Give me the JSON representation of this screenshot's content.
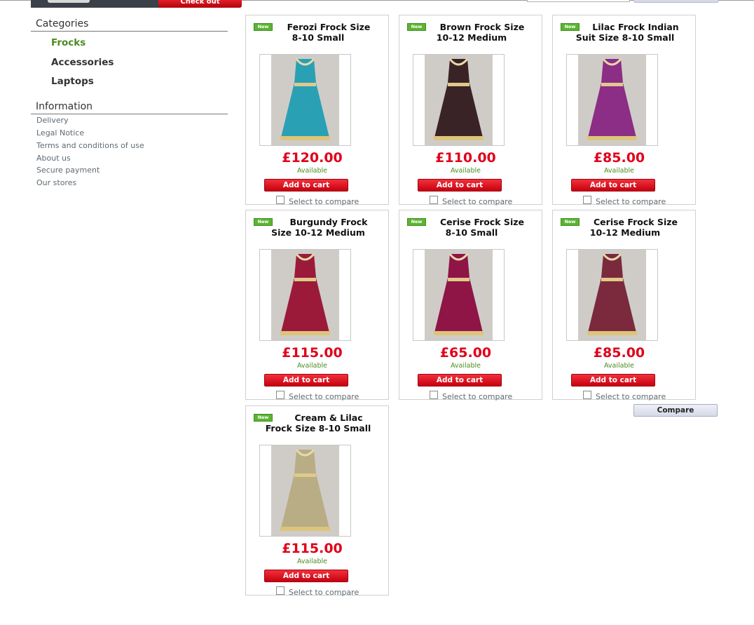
{
  "header": {
    "checkout_label": "Check out"
  },
  "sidebar": {
    "categories_title": "Categories",
    "categories": [
      {
        "label": "Frocks",
        "active": true
      },
      {
        "label": "Accessories",
        "active": false
      },
      {
        "label": "Laptops",
        "active": false
      }
    ],
    "information_title": "Information",
    "information_links": [
      "Delivery",
      "Legal Notice",
      "Terms and conditions of use",
      "About us",
      "Secure payment",
      "Our stores"
    ]
  },
  "products": [
    {
      "badge": "New",
      "title_line1": "Ferozi Frock Size",
      "title_line2": "8-10 Small",
      "price": "£120.00",
      "availability": "Available",
      "add_label": "Add to cart",
      "compare_label": "Select to compare",
      "dress_color": "#2aa0b4"
    },
    {
      "badge": "New",
      "title_line1": "Brown Frock Size",
      "title_line2": "10-12 Medium",
      "price": "£110.00",
      "availability": "Available",
      "add_label": "Add to cart",
      "compare_label": "Select to compare",
      "dress_color": "#3a2327"
    },
    {
      "badge": "New",
      "title_line1": "Lilac Frock Indian",
      "title_line2": "Suit Size 8-10 Small",
      "price": "£85.00",
      "availability": "Available",
      "add_label": "Add to cart",
      "compare_label": "Select to compare",
      "dress_color": "#8c2d86"
    },
    {
      "badge": "New",
      "title_line1": "Burgundy Frock",
      "title_line2": "Size 10-12 Medium",
      "price": "£115.00",
      "availability": "Available",
      "add_label": "Add to cart",
      "compare_label": "Select to compare",
      "dress_color": "#9b1a3a"
    },
    {
      "badge": "New",
      "title_line1": "Cerise Frock Size",
      "title_line2": "8-10 Small",
      "price": "£65.00",
      "availability": "Available",
      "add_label": "Add to cart",
      "compare_label": "Select to compare",
      "dress_color": "#8e1546"
    },
    {
      "badge": "New",
      "title_line1": "Cerise Frock Size",
      "title_line2": "10-12 Medium",
      "price": "£85.00",
      "availability": "Available",
      "add_label": "Add to cart",
      "compare_label": "Select to compare",
      "dress_color": "#7a2a3c"
    },
    {
      "badge": "New",
      "title_line1": "Cream & Lilac",
      "title_line2": "Frock Size 8-10 Small",
      "price": "£115.00",
      "availability": "Available",
      "add_label": "Add to cart",
      "compare_label": "Select to compare",
      "dress_color": "#b9ad86"
    }
  ],
  "compare_button_label": "Compare",
  "colors": {
    "accent_green": "#488c1e",
    "price_red": "#e0001a",
    "button_red": "#d0101c"
  }
}
